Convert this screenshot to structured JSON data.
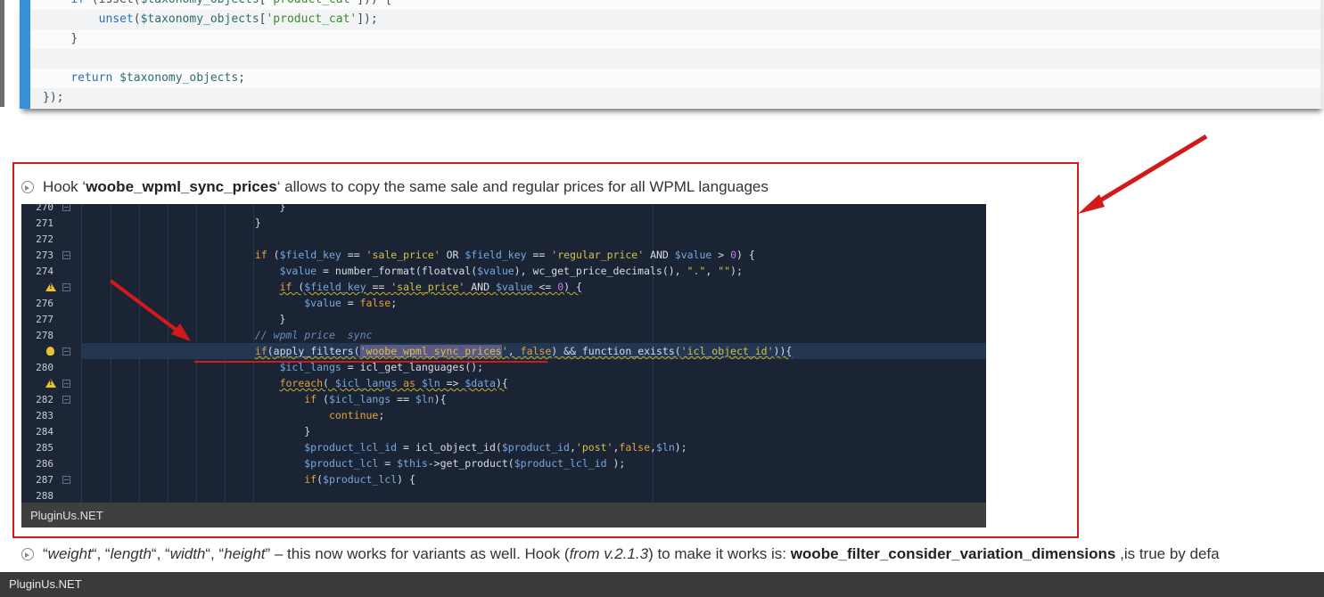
{
  "top_code": {
    "lines": [
      {
        "indent": "    ",
        "parts": [
          [
            "kw",
            "if"
          ],
          [
            "pun",
            " (isset("
          ],
          [
            "var",
            "$taxonomy_objects"
          ],
          [
            "pun",
            "["
          ],
          [
            "str",
            "'product_cat'"
          ],
          [
            "pun",
            "])) {"
          ]
        ]
      },
      {
        "indent": "        ",
        "parts": [
          [
            "kw",
            "unset"
          ],
          [
            "pun",
            "("
          ],
          [
            "var",
            "$taxonomy_objects"
          ],
          [
            "pun",
            "["
          ],
          [
            "str",
            "'product_cat'"
          ],
          [
            "pun",
            "]);"
          ]
        ]
      },
      {
        "indent": "    ",
        "parts": [
          [
            "pun",
            "}"
          ]
        ]
      },
      {
        "indent": "",
        "parts": []
      },
      {
        "indent": "    ",
        "parts": [
          [
            "kw",
            "return"
          ],
          [
            "pun",
            " "
          ],
          [
            "var",
            "$taxonomy_objects"
          ],
          [
            "pun",
            ";"
          ]
        ]
      },
      {
        "indent": "",
        "parts": [
          [
            "pun",
            "});"
          ]
        ]
      }
    ]
  },
  "hook_item": {
    "prefix": "Hook ‘",
    "hook_name": "woobe_wpml_sync_prices",
    "suffix": "‘ allows to copy the same sale and regular prices for all WPML languages"
  },
  "ide": {
    "line_numbers": [
      "270",
      "271",
      "272",
      "273",
      "274",
      "",
      "276",
      "277",
      "278",
      "",
      "280",
      "",
      "282",
      "283",
      "284",
      "285",
      "286",
      "287",
      "288"
    ],
    "warning_rows": [
      5,
      11
    ],
    "bulb_row": 9,
    "fold_rows": [
      0,
      3,
      5,
      9,
      11,
      12,
      17
    ],
    "current_row": 9,
    "caption": "PluginUs.NET"
  },
  "description": {
    "q1": "“",
    "weight": "weight",
    "sep1": "“, “",
    "length": "length",
    "sep2": "“, “",
    "width": "width",
    "sep3": "“, “",
    "height": "height",
    "rest1": "” – this now works for variants as well. Hook (",
    "from_version": "from v.2.1.3",
    "rest2": ") to make it works is:  ",
    "filter_name": "woobe_filter_consider_variation_dimensions",
    "rest3": " ,is true by defa"
  },
  "footer": {
    "brand": "PluginUs.NET"
  },
  "colors": {
    "accent": "#3a8fd9",
    "highlight_frame": "#d21a1a",
    "ide_bg": "#1b2434"
  }
}
